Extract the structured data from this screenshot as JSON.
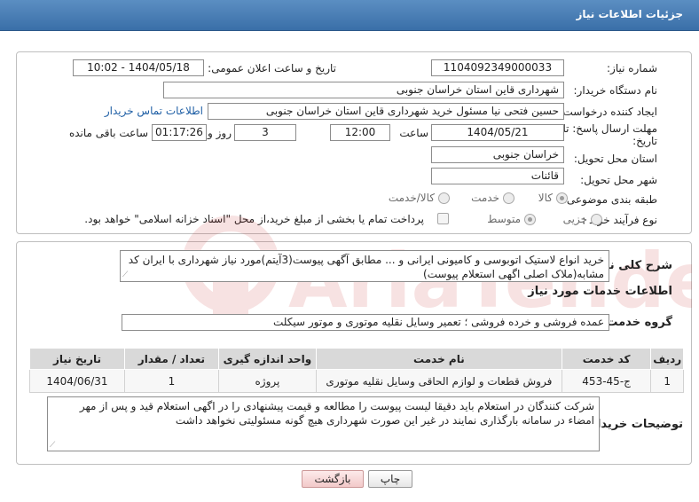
{
  "header": {
    "title": "جزئیات اطلاعات نیاز"
  },
  "form": {
    "need_number_label": "شماره نیاز:",
    "need_number": "1104092349000033",
    "announce_label": "تاریخ و ساعت اعلان عمومی:",
    "announce_value": "1404/05/18 - 10:02",
    "buyer_org_label": "نام دستگاه خریدار:",
    "buyer_org": "شهرداری قاین استان خراسان جنوبی",
    "creator_label": "ایجاد کننده درخواست:",
    "creator": "حسین فتحی نیا مسئول خرید شهرداری قاین استان خراسان جنوبی",
    "contact_link": "اطلاعات تماس خریدار",
    "deadline_label_1": "مهلت ارسال پاسخ: تا",
    "deadline_label_2": "تاریخ:",
    "deadline_date": "1404/05/21",
    "time_label": "ساعت",
    "deadline_time": "12:00",
    "days": "3",
    "days_label": "روز و",
    "remaining": "01:17:26",
    "remaining_label": "ساعت باقی مانده",
    "province_label": "استان محل تحویل:",
    "province": "خراسان جنوبی",
    "city_label": "شهر محل تحویل:",
    "city": "قائنات",
    "category_label": "طبقه بندی موضوعی:",
    "category_options": [
      "کالا",
      "خدمت",
      "کالا/خدمت"
    ],
    "category_selected": "کالا",
    "process_label": "نوع فرآیند خرید :",
    "process_options": [
      "جزیی",
      "متوسط"
    ],
    "process_selected": "متوسط",
    "payment_note": "پرداخت تمام یا بخشی از مبلغ خرید،از محل \"اسناد خزانه اسلامی\" خواهد بود."
  },
  "description": {
    "label": "شرح کلی نیاز:",
    "text": "خرید انواع لاستیک اتوبوسی و کامیونی ایرانی و ... مطابق آگهی پیوست(3آیتم)مورد نیاز شهرداری با ایران کد مشابه(ملاک اصلی اگهی استعلام پیوست)"
  },
  "services": {
    "section_title": "اطلاعات خدمات مورد نیاز",
    "group_label": "گروه خدمت:",
    "group_value": "عمده فروشی و خرده فروشی ؛ تعمیر وسایل نقلیه موتوری و موتور سیکلت",
    "columns": [
      "ردیف",
      "کد خدمت",
      "نام خدمت",
      "واحد اندازه گیری",
      "تعداد / مقدار",
      "تاریخ نیاز"
    ],
    "rows": [
      [
        "1",
        "ج-45-453",
        "فروش قطعات و لوازم الحاقی وسایل نقلیه موتوری",
        "پروژه",
        "1",
        "1404/06/31"
      ]
    ]
  },
  "buyer_notes": {
    "label": "توضیحات خریدار:",
    "text": "شرکت کنندگان در استعلام باید دقیقا لیست پیوست را مطالعه و قیمت پیشنهادی را در اگهی استعلام قید و پس از مهر امضاء در سامانه بارگذاری نمایند در غیر این صورت شهرداری هیچ گونه مسئولیتی نخواهد داشت"
  },
  "buttons": {
    "print": "چاپ",
    "back": "بازگشت"
  },
  "watermark": {
    "text": "AriaTender.net"
  }
}
